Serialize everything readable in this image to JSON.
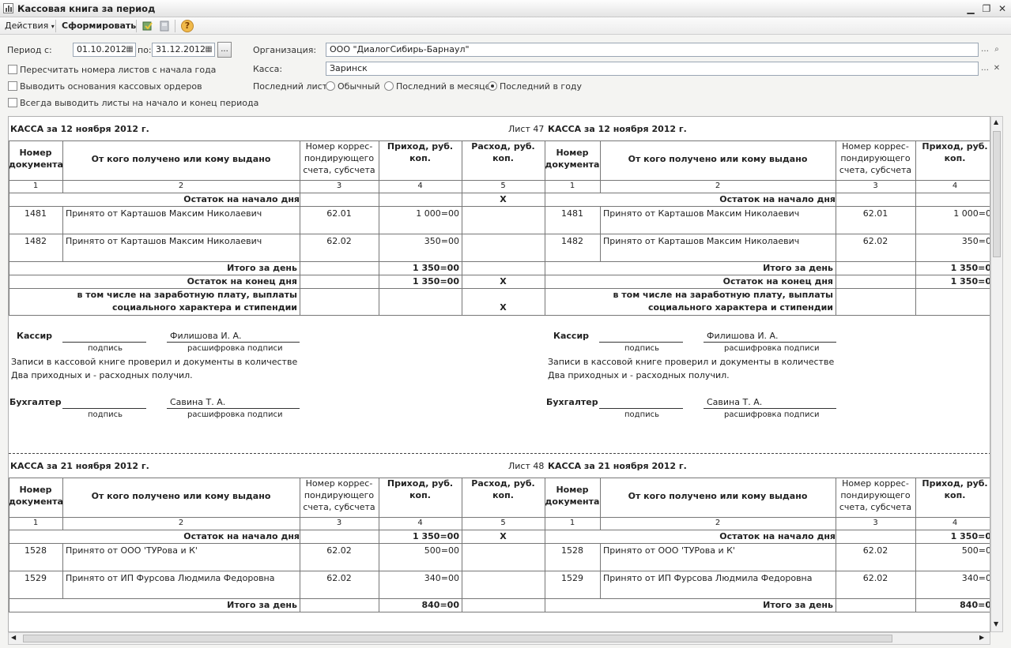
{
  "window": {
    "title": "Кассовая книга за период"
  },
  "toolbar": {
    "actions": "Действия",
    "generate": "Сформировать",
    "help": "?"
  },
  "params": {
    "period_from_label": "Период с:",
    "period_from": "01.10.2012",
    "period_to_label": "по:",
    "period_to": "31.12.2012",
    "dots": "...",
    "org_label": "Организация:",
    "org_value": "ООО \"ДиалогСибирь-Барнаул\"",
    "cash_label": "Касса:",
    "cash_value": "Заринск",
    "recount": "Пересчитать номера листов с начала года",
    "show_basis": "Выводить основания кассовых ордеров",
    "always_sheets": "Всегда выводить листы на начало и конец периода",
    "last_sheet_label": "Последний лист:",
    "radio_normal": "Обычный",
    "radio_month": "Последний в месяце",
    "radio_year": "Последний в году"
  },
  "header": {
    "doc_no": "Номер документа",
    "from_to": "От кого получено или кому выдано",
    "acc": "Номер коррес- пондирующего счета, субсчета",
    "income": "Приход, руб. коп.",
    "expense": "Расход, руб. коп.",
    "n1": "1",
    "n2": "2",
    "n3": "3",
    "n4": "4",
    "n5": "5",
    "opening": "Остаток на начало дня",
    "total_day": "Итого за день",
    "closing": "Остаток на конец  дня",
    "incl": "в том числе на заработную плату, выплаты социального характера и стипендии",
    "x": "X"
  },
  "sign": {
    "cashier": "Кассир",
    "cashier_name": "Филишова И. А.",
    "signature": "подпись",
    "decoding": "расшифровка подписи",
    "note1": "Записи в кассовой книге проверил и документы в количестве",
    "note2": "Два приходных и  - расходных получил.",
    "accountant": "Бухгалтер",
    "accountant_name": "Савина Т. А."
  },
  "sheet1": {
    "title": "КАССА за 12 ноября 2012 г.",
    "sheet_no": "Лист 47",
    "rows": [
      {
        "no": "1481",
        "text": "Принято от Карташов Максим Николаевич",
        "acc": "62.01",
        "income": "1 000=00",
        "income_r": "1 000=0"
      },
      {
        "no": "1482",
        "text": "Принято от Карташов Максим Николаевич",
        "acc": "62.02",
        "income": "350=00",
        "income_r": "350=0"
      }
    ],
    "total": "1 350=00",
    "total_r": "1 350=0",
    "closing": "1 350=00",
    "closing_r": "1 350=0"
  },
  "sheet2": {
    "title": "КАССА за 21 ноября 2012 г.",
    "sheet_no": "Лист 48",
    "opening": "1 350=00",
    "opening_r": "1 350=0",
    "rows": [
      {
        "no": "1528",
        "text": "Принято от ООО 'ТУРова и К'",
        "acc": "62.02",
        "income": "500=00",
        "income_r": "500=0"
      },
      {
        "no": "1529",
        "text": "Принято от ИП Фурсова Людмила Федоровна",
        "acc": "62.02",
        "income": "340=00",
        "income_r": "340=0"
      }
    ],
    "total": "840=00",
    "total_r": "840=0"
  }
}
